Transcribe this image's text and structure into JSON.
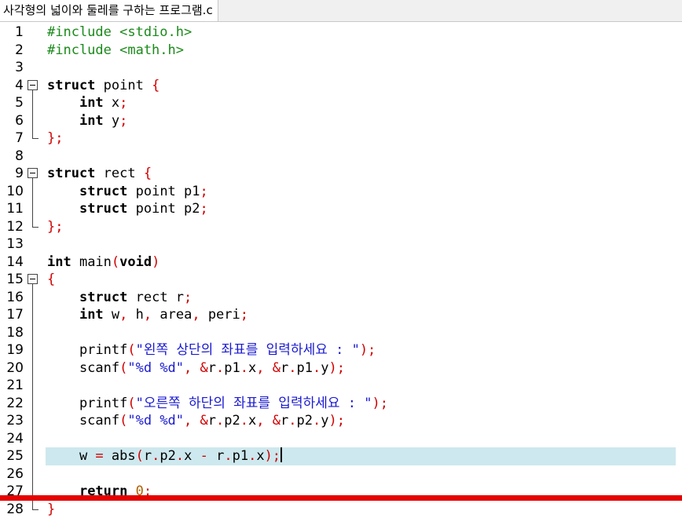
{
  "tab": {
    "title": "사각형의 넓이와 둘레를 구하는 프로그램.c"
  },
  "editor": {
    "current_line": 25,
    "lines": [
      {
        "num": "1",
        "fold": "none",
        "tokens": [
          [
            "pp",
            "#include <stdio.h>"
          ]
        ]
      },
      {
        "num": "2",
        "fold": "none",
        "tokens": [
          [
            "pp",
            "#include <math.h>"
          ]
        ]
      },
      {
        "num": "3",
        "fold": "none",
        "tokens": []
      },
      {
        "num": "4",
        "fold": "start",
        "tokens": [
          [
            "kw",
            "struct"
          ],
          [
            "t",
            " point "
          ],
          [
            "op",
            "{"
          ]
        ]
      },
      {
        "num": "5",
        "fold": "mid",
        "tokens": [
          [
            "t",
            "    "
          ],
          [
            "kw",
            "int"
          ],
          [
            "t",
            " x"
          ],
          [
            "op",
            ";"
          ]
        ]
      },
      {
        "num": "6",
        "fold": "mid",
        "tokens": [
          [
            "t",
            "    "
          ],
          [
            "kw",
            "int"
          ],
          [
            "t",
            " y"
          ],
          [
            "op",
            ";"
          ]
        ]
      },
      {
        "num": "7",
        "fold": "end",
        "tokens": [
          [
            "op",
            "};"
          ]
        ]
      },
      {
        "num": "8",
        "fold": "none",
        "tokens": []
      },
      {
        "num": "9",
        "fold": "start",
        "tokens": [
          [
            "kw",
            "struct"
          ],
          [
            "t",
            " rect "
          ],
          [
            "op",
            "{"
          ]
        ]
      },
      {
        "num": "10",
        "fold": "mid",
        "tokens": [
          [
            "t",
            "    "
          ],
          [
            "kw",
            "struct"
          ],
          [
            "t",
            " point p1"
          ],
          [
            "op",
            ";"
          ]
        ]
      },
      {
        "num": "11",
        "fold": "mid",
        "tokens": [
          [
            "t",
            "    "
          ],
          [
            "kw",
            "struct"
          ],
          [
            "t",
            " point p2"
          ],
          [
            "op",
            ";"
          ]
        ]
      },
      {
        "num": "12",
        "fold": "end",
        "tokens": [
          [
            "op",
            "};"
          ]
        ]
      },
      {
        "num": "13",
        "fold": "none",
        "tokens": []
      },
      {
        "num": "14",
        "fold": "none",
        "tokens": [
          [
            "kw",
            "int"
          ],
          [
            "t",
            " main"
          ],
          [
            "op",
            "("
          ],
          [
            "kw",
            "void"
          ],
          [
            "op",
            ")"
          ]
        ]
      },
      {
        "num": "15",
        "fold": "start",
        "tokens": [
          [
            "op",
            "{"
          ]
        ]
      },
      {
        "num": "16",
        "fold": "mid",
        "tokens": [
          [
            "t",
            "    "
          ],
          [
            "kw",
            "struct"
          ],
          [
            "t",
            " rect r"
          ],
          [
            "op",
            ";"
          ]
        ]
      },
      {
        "num": "17",
        "fold": "mid",
        "tokens": [
          [
            "t",
            "    "
          ],
          [
            "kw",
            "int"
          ],
          [
            "t",
            " w"
          ],
          [
            "op",
            ","
          ],
          [
            "t",
            " h"
          ],
          [
            "op",
            ","
          ],
          [
            "t",
            " area"
          ],
          [
            "op",
            ","
          ],
          [
            "t",
            " peri"
          ],
          [
            "op",
            ";"
          ]
        ]
      },
      {
        "num": "18",
        "fold": "mid",
        "tokens": []
      },
      {
        "num": "19",
        "fold": "mid",
        "tokens": [
          [
            "t",
            "    printf"
          ],
          [
            "op",
            "("
          ],
          [
            "str",
            "\"왼쪽 상단의 좌표를 입력하세요 : \""
          ],
          [
            "op",
            ");"
          ]
        ]
      },
      {
        "num": "20",
        "fold": "mid",
        "tokens": [
          [
            "t",
            "    scanf"
          ],
          [
            "op",
            "("
          ],
          [
            "str",
            "\"%d %d\""
          ],
          [
            "op",
            ","
          ],
          [
            "t",
            " "
          ],
          [
            "op",
            "&"
          ],
          [
            "t",
            "r"
          ],
          [
            "op",
            "."
          ],
          [
            "t",
            "p1"
          ],
          [
            "op",
            "."
          ],
          [
            "t",
            "x"
          ],
          [
            "op",
            ","
          ],
          [
            "t",
            " "
          ],
          [
            "op",
            "&"
          ],
          [
            "t",
            "r"
          ],
          [
            "op",
            "."
          ],
          [
            "t",
            "p1"
          ],
          [
            "op",
            "."
          ],
          [
            "t",
            "y"
          ],
          [
            "op",
            ");"
          ]
        ]
      },
      {
        "num": "21",
        "fold": "mid",
        "tokens": []
      },
      {
        "num": "22",
        "fold": "mid",
        "tokens": [
          [
            "t",
            "    printf"
          ],
          [
            "op",
            "("
          ],
          [
            "str",
            "\"오른쪽 하단의 좌표를 입력하세요 : \""
          ],
          [
            "op",
            ");"
          ]
        ]
      },
      {
        "num": "23",
        "fold": "mid",
        "tokens": [
          [
            "t",
            "    scanf"
          ],
          [
            "op",
            "("
          ],
          [
            "str",
            "\"%d %d\""
          ],
          [
            "op",
            ","
          ],
          [
            "t",
            " "
          ],
          [
            "op",
            "&"
          ],
          [
            "t",
            "r"
          ],
          [
            "op",
            "."
          ],
          [
            "t",
            "p2"
          ],
          [
            "op",
            "."
          ],
          [
            "t",
            "x"
          ],
          [
            "op",
            ","
          ],
          [
            "t",
            " "
          ],
          [
            "op",
            "&"
          ],
          [
            "t",
            "r"
          ],
          [
            "op",
            "."
          ],
          [
            "t",
            "p2"
          ],
          [
            "op",
            "."
          ],
          [
            "t",
            "y"
          ],
          [
            "op",
            ");"
          ]
        ]
      },
      {
        "num": "24",
        "fold": "mid",
        "tokens": []
      },
      {
        "num": "25",
        "fold": "mid",
        "tokens": [
          [
            "t",
            "    w "
          ],
          [
            "op",
            "="
          ],
          [
            "t",
            " abs"
          ],
          [
            "op",
            "("
          ],
          [
            "t",
            "r"
          ],
          [
            "op",
            "."
          ],
          [
            "t",
            "p2"
          ],
          [
            "op",
            "."
          ],
          [
            "t",
            "x "
          ],
          [
            "op",
            "-"
          ],
          [
            "t",
            " r"
          ],
          [
            "op",
            "."
          ],
          [
            "t",
            "p1"
          ],
          [
            "op",
            "."
          ],
          [
            "t",
            "x"
          ],
          [
            "op",
            ");"
          ],
          [
            "caret",
            ""
          ]
        ]
      },
      {
        "num": "26",
        "fold": "mid",
        "tokens": []
      },
      {
        "num": "27",
        "fold": "mid",
        "tokens": [
          [
            "t",
            "    "
          ],
          [
            "kw",
            "return"
          ],
          [
            "t",
            " "
          ],
          [
            "num",
            "0"
          ],
          [
            "op",
            ";"
          ]
        ]
      },
      {
        "num": "28",
        "fold": "end",
        "tokens": [
          [
            "op",
            "}"
          ]
        ]
      }
    ]
  },
  "colors": {
    "preprocessor": "#1a8a1a",
    "string": "#1a1ad0",
    "operator": "#d00000",
    "current_line_bg": "#cde8ee",
    "red_bar": "#e60000"
  }
}
